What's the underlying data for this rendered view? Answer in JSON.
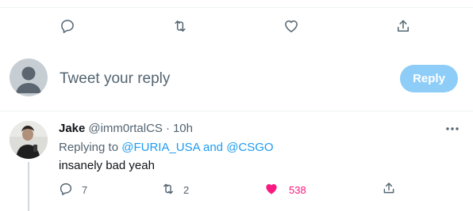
{
  "top_actions": {
    "reply_icon": "reply-icon",
    "retweet_icon": "retweet-icon",
    "like_icon": "heart-icon",
    "share_icon": "share-icon"
  },
  "composer": {
    "placeholder": "Tweet your reply",
    "reply_label": "Reply"
  },
  "reply_tweet": {
    "display_name": "Jake",
    "handle": "@imm0rtalCS",
    "separator": "·",
    "time": "10h",
    "replying_prefix": "Replying to",
    "mention_1": "@FURIA_USA",
    "joiner": "and",
    "mention_2": "@CSGO",
    "text": "insanely bad yeah",
    "reply_count": "7",
    "retweet_count": "2",
    "like_count": "538",
    "liked": true
  },
  "colors": {
    "accent": "#1d9bf0",
    "reply_button_disabled": "#8ecdf8",
    "like_active": "#f91880",
    "secondary_text": "#536471"
  }
}
